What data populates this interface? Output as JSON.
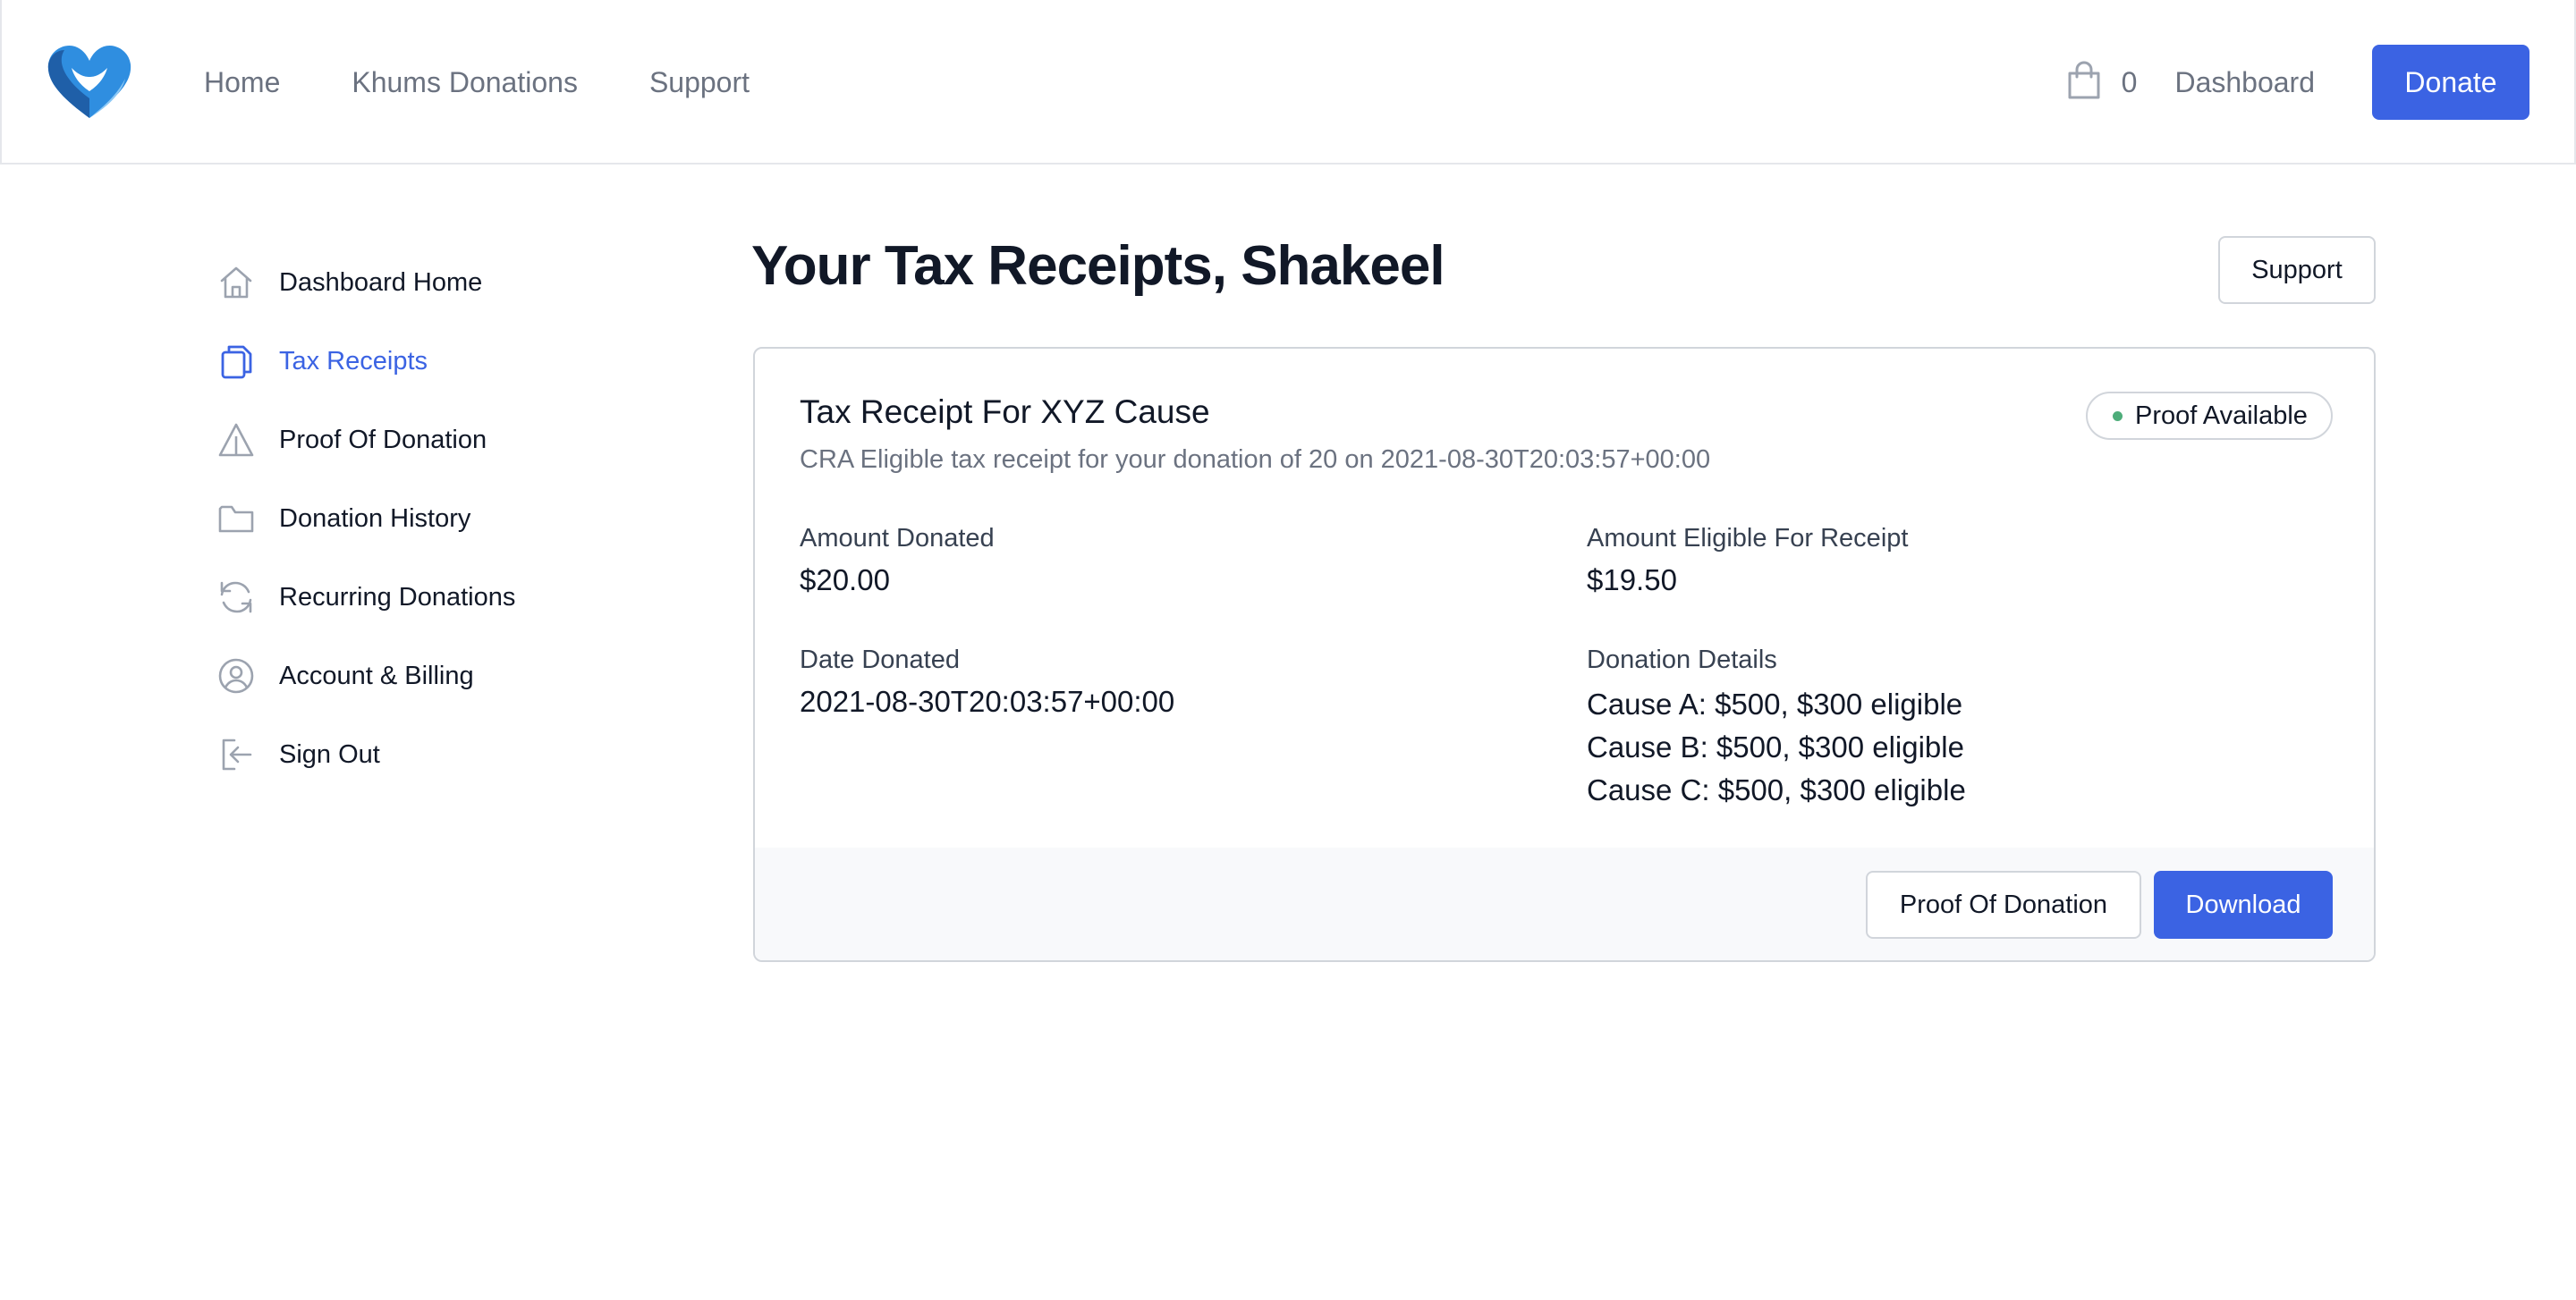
{
  "nav": {
    "logo_icon": "heart-logo-icon",
    "links": [
      "Home",
      "Khums Donations",
      "Support"
    ],
    "cart_count": "0",
    "dashboard_label": "Dashboard",
    "donate_label": "Donate"
  },
  "sidebar": {
    "items": [
      {
        "label": "Dashboard Home",
        "icon": "home-icon",
        "active": false
      },
      {
        "label": "Tax Receipts",
        "icon": "documents-icon",
        "active": true
      },
      {
        "label": "Proof Of Donation",
        "icon": "warning-triangle-icon",
        "active": false
      },
      {
        "label": "Donation History",
        "icon": "folder-icon",
        "active": false
      },
      {
        "label": "Recurring Donations",
        "icon": "refresh-icon",
        "active": false
      },
      {
        "label": "Account & Billing",
        "icon": "user-circle-icon",
        "active": false
      },
      {
        "label": "Sign Out",
        "icon": "sign-out-icon",
        "active": false
      }
    ]
  },
  "main": {
    "title": "Your Tax Receipts, Shakeel",
    "support_label": "Support",
    "receipt": {
      "title": "Tax Receipt For XYZ Cause",
      "subtitle": "CRA Eligible tax receipt for your donation of 20 on 2021-08-30T20:03:57+00:00",
      "badge": "Proof Available",
      "amount_donated_label": "Amount Donated",
      "amount_donated": "$20.00",
      "amount_eligible_label": "Amount Eligible For Receipt",
      "amount_eligible": "$19.50",
      "date_label": "Date Donated",
      "date": "2021-08-30T20:03:57+00:00",
      "details_label": "Donation Details",
      "details": [
        "Cause A: $500, $300 eligible",
        "Cause B: $500, $300 eligible",
        "Cause C: $500, $300 eligible"
      ],
      "proof_button": "Proof Of Donation",
      "download_button": "Download"
    }
  },
  "colors": {
    "accent": "#3b63e3",
    "muted_text": "#6b7280",
    "badge_dot": "#4ead7a"
  }
}
